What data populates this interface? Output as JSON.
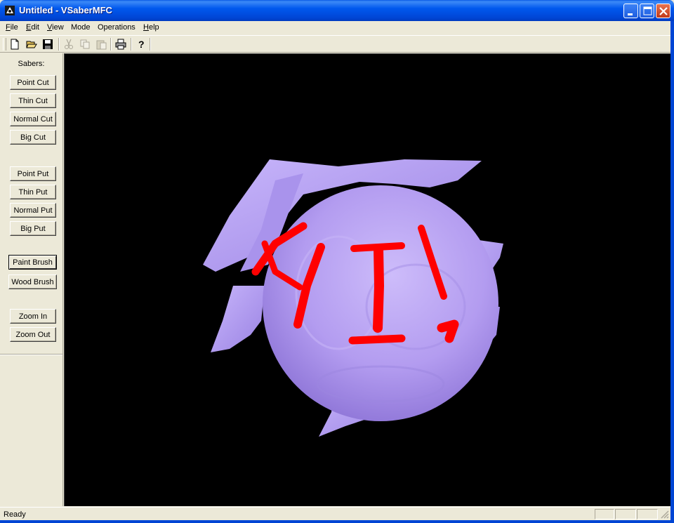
{
  "window": {
    "title": "Untitled - VSaberMFC"
  },
  "menu": {
    "items": [
      {
        "underline": "F",
        "rest": "ile"
      },
      {
        "underline": "E",
        "rest": "dit"
      },
      {
        "underline": "V",
        "rest": "iew"
      },
      {
        "underline": "",
        "rest": "Mode"
      },
      {
        "underline": "",
        "rest": "Operations"
      },
      {
        "underline": "H",
        "rest": "elp"
      }
    ]
  },
  "toolbar": {
    "icons": [
      "new-file-icon",
      "open-folder-icon",
      "save-disk-icon",
      "cut-scissors-icon",
      "copy-icon",
      "paste-icon",
      "print-icon",
      "help-icon"
    ],
    "disabled": [
      "cut-scissors-icon",
      "copy-icon",
      "paste-icon"
    ]
  },
  "sidepanel": {
    "label": "Sabers:",
    "cut_buttons": [
      "Point Cut",
      "Thin Cut",
      "Normal Cut",
      "Big Cut"
    ],
    "put_buttons": [
      "Point Put",
      "Thin Put",
      "Normal Put",
      "Big Put"
    ],
    "brush_buttons": [
      "Paint Brush",
      "Wood Brush"
    ],
    "active_button": "Paint Brush",
    "zoom_buttons": [
      "Zoom In",
      "Zoom Out"
    ]
  },
  "viewport": {
    "background": "#000000",
    "object_color": "#b9a3f2",
    "paint_color": "#ff0000"
  },
  "statusbar": {
    "text": "Ready"
  },
  "colors": {
    "titlebar": "#0058ee",
    "chrome": "#ece9d8"
  }
}
